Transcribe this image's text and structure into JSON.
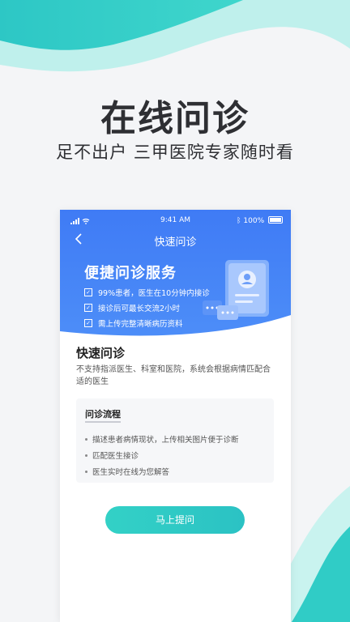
{
  "promo": {
    "headline": "在线问诊",
    "subline": "足不出户 三甲医院专家随时看"
  },
  "colors": {
    "brand_teal": "#2fcdc4",
    "banner_blue": "#4283f6",
    "page_bg": "#f4f5f7"
  },
  "phone": {
    "status_bar": {
      "time": "9:41 AM",
      "battery": "100%",
      "icons": [
        "signal-icon",
        "wifi-icon",
        "bluetooth-icon",
        "battery-icon"
      ]
    },
    "nav": {
      "back_icon": "chevron-left-icon",
      "title": "快速问诊"
    },
    "banner": {
      "title": "便捷问诊服务",
      "items": [
        "99%患者，医生在10分钟内接诊",
        "接诊后可最长交流2小时",
        "需上传完整清晰病历资料"
      ]
    },
    "card": {
      "title": "快速问诊",
      "description": "不支持指派医生、科室和医院，系统会根据病情匹配合适的医生"
    },
    "flow": {
      "title": "问诊流程",
      "steps": [
        "描述患者病情现状，上传相关图片便于诊断",
        "匹配医生接诊",
        "医生实时在线为您解答"
      ]
    },
    "button_label": "马上提问"
  }
}
